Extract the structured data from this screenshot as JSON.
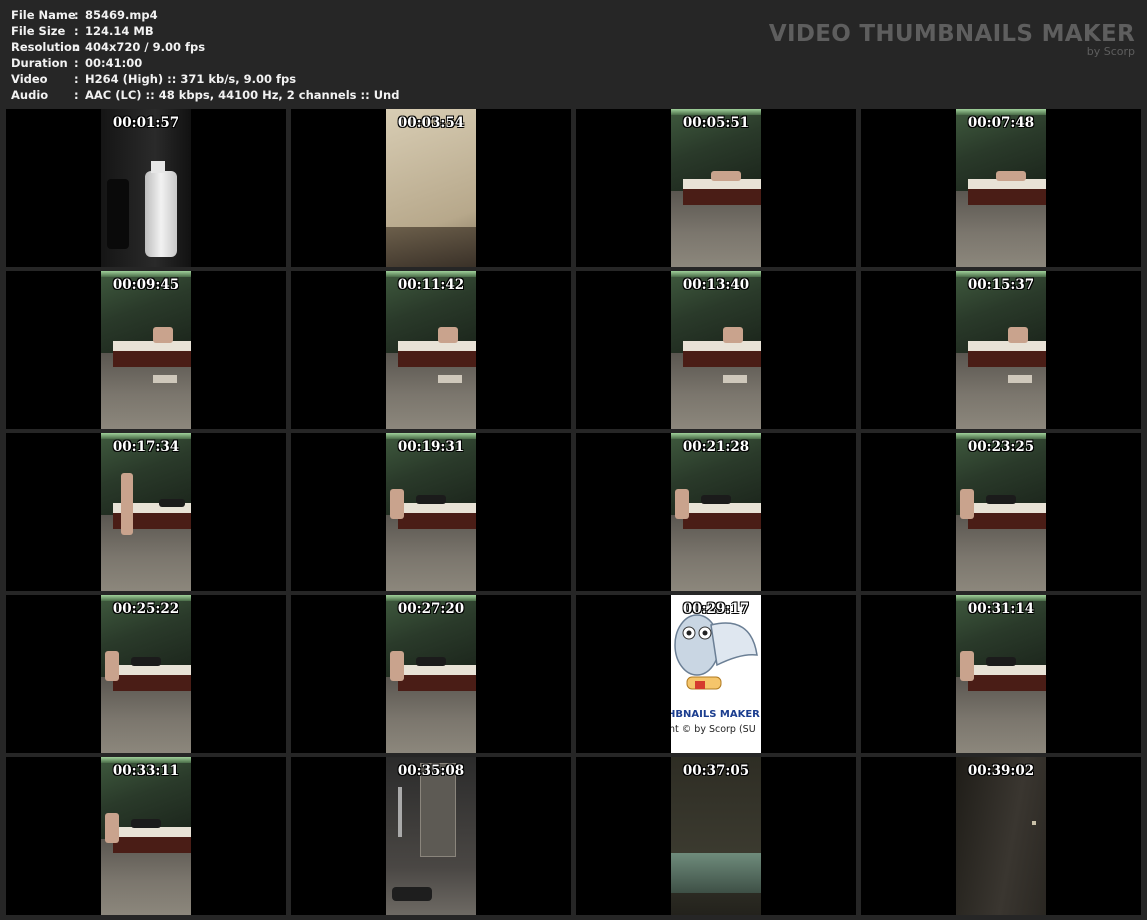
{
  "header": {
    "rows": [
      {
        "label": "File Name",
        "value": "85469.mp4"
      },
      {
        "label": "File Size",
        "value": "124.14 MB"
      },
      {
        "label": "Resolution",
        "value": "404x720 / 9.00 fps"
      },
      {
        "label": "Duration",
        "value": "00:41:00"
      },
      {
        "label": "Video",
        "value": "H264 (High) :: 371 kb/s, 9.00 fps"
      },
      {
        "label": "Audio",
        "value": "AAC (LC) :: 48 kbps, 44100 Hz, 2 channels :: Und"
      }
    ],
    "separator": ":"
  },
  "brand": {
    "title": "VIDEO THUMBNAILS MAKER",
    "subtitle": "by Scorp"
  },
  "thumbnails": [
    {
      "time": "00:01:57",
      "scene": "bottles"
    },
    {
      "time": "00:03:54",
      "scene": "beige"
    },
    {
      "time": "00:05:51",
      "scene": "room-a"
    },
    {
      "time": "00:07:48",
      "scene": "room-a"
    },
    {
      "time": "00:09:45",
      "scene": "room-b"
    },
    {
      "time": "00:11:42",
      "scene": "room-b"
    },
    {
      "time": "00:13:40",
      "scene": "room-b"
    },
    {
      "time": "00:15:37",
      "scene": "room-b"
    },
    {
      "time": "00:17:34",
      "scene": "room-c"
    },
    {
      "time": "00:19:31",
      "scene": "room-d"
    },
    {
      "time": "00:21:28",
      "scene": "room-d"
    },
    {
      "time": "00:23:25",
      "scene": "room-d"
    },
    {
      "time": "00:25:22",
      "scene": "room-d"
    },
    {
      "time": "00:27:20",
      "scene": "room-d"
    },
    {
      "time": "00:29:17",
      "scene": "logo"
    },
    {
      "time": "00:31:14",
      "scene": "room-d"
    },
    {
      "time": "00:33:11",
      "scene": "room-d"
    },
    {
      "time": "00:35:08",
      "scene": "door"
    },
    {
      "time": "00:37:05",
      "scene": "dark-green"
    },
    {
      "time": "00:39:02",
      "scene": "dark"
    }
  ],
  "logo_frame": {
    "line1": "HBNAILS MAKER",
    "line2": "nt © by Scorp (SU"
  }
}
